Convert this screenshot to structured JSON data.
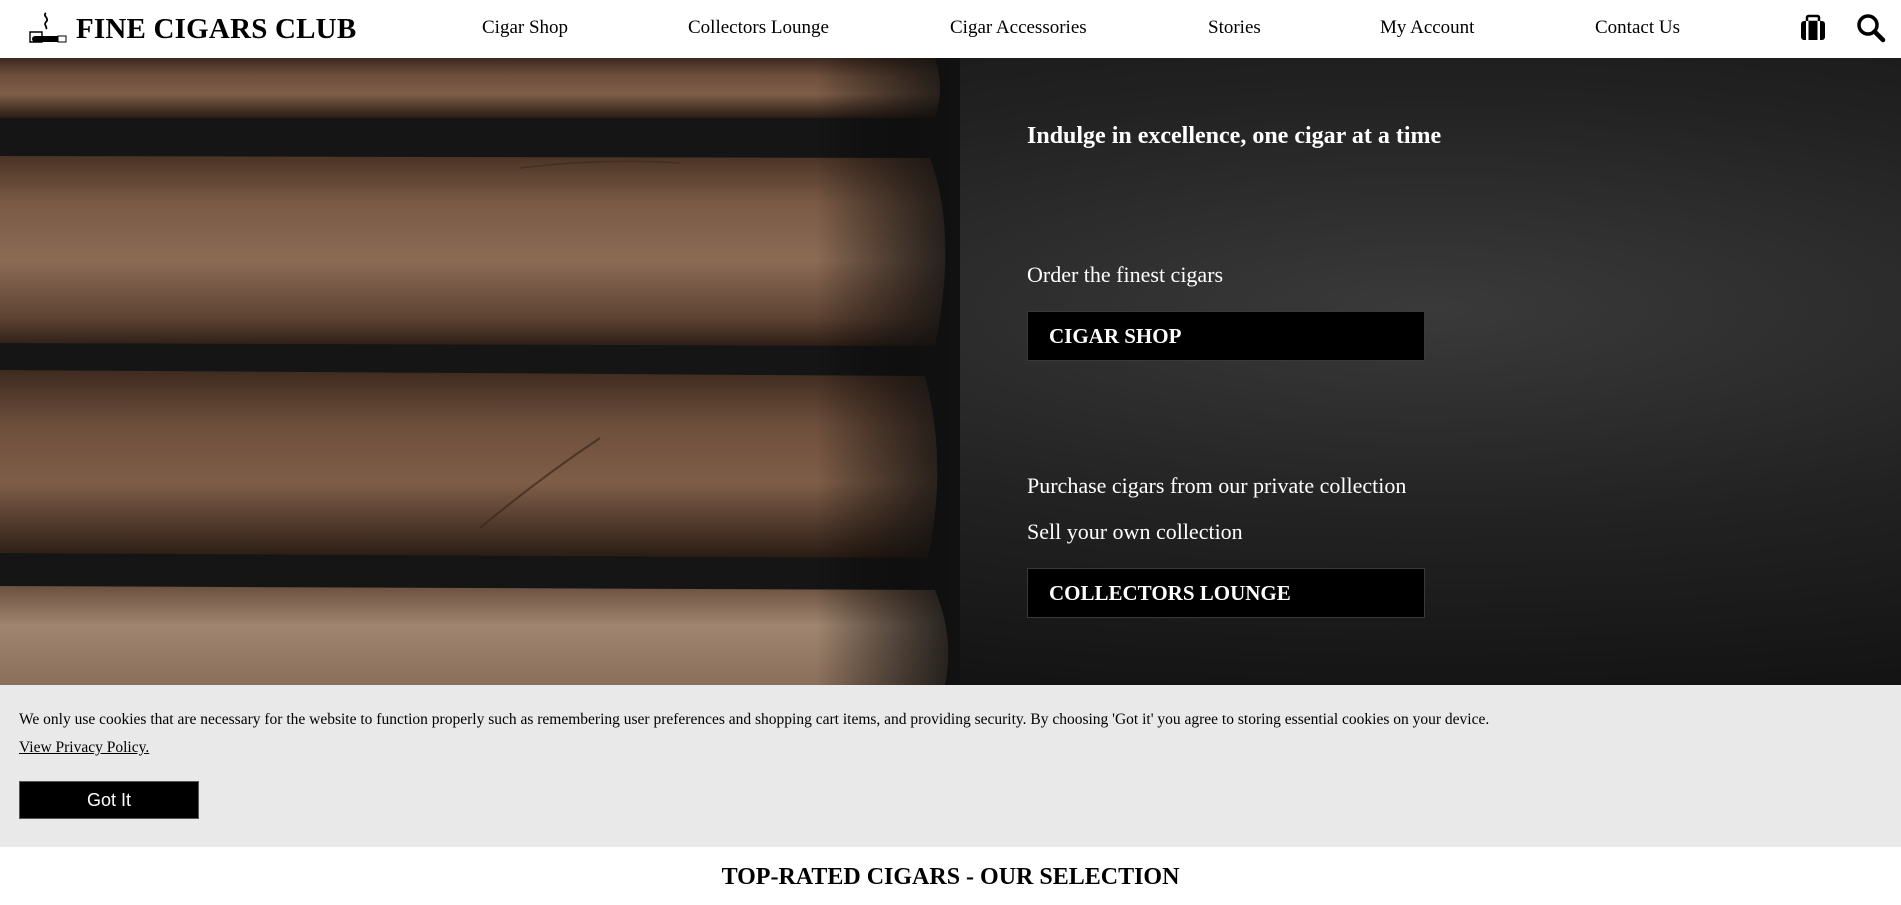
{
  "header": {
    "logo_text": "FINE CIGARS CLUB",
    "nav": [
      "Cigar Shop",
      "Collectors Lounge",
      "Cigar Accessories",
      "Stories",
      "My Account",
      "Contact Us"
    ],
    "icons": [
      "cart-icon",
      "search-icon"
    ]
  },
  "hero": {
    "tagline": "Indulge in excellence, one cigar at a time",
    "shop_text": "Order the finest cigars",
    "shop_button": "CIGAR SHOP",
    "collection_text_1": "Purchase cigars from our private collection",
    "collection_text_2": "Sell your own collection",
    "lounge_button": "COLLECTORS LOUNGE"
  },
  "cookie_banner": {
    "message": "We only use cookies that are necessary for the website to function properly such as remembering user preferences and shopping cart items, and providing security. By choosing 'Got it' you agree to storing essential cookies on your device.",
    "privacy_link": "View Privacy Policy.",
    "button": "Got It"
  },
  "section": {
    "title": "TOP-RATED CIGARS - OUR SELECTION"
  }
}
